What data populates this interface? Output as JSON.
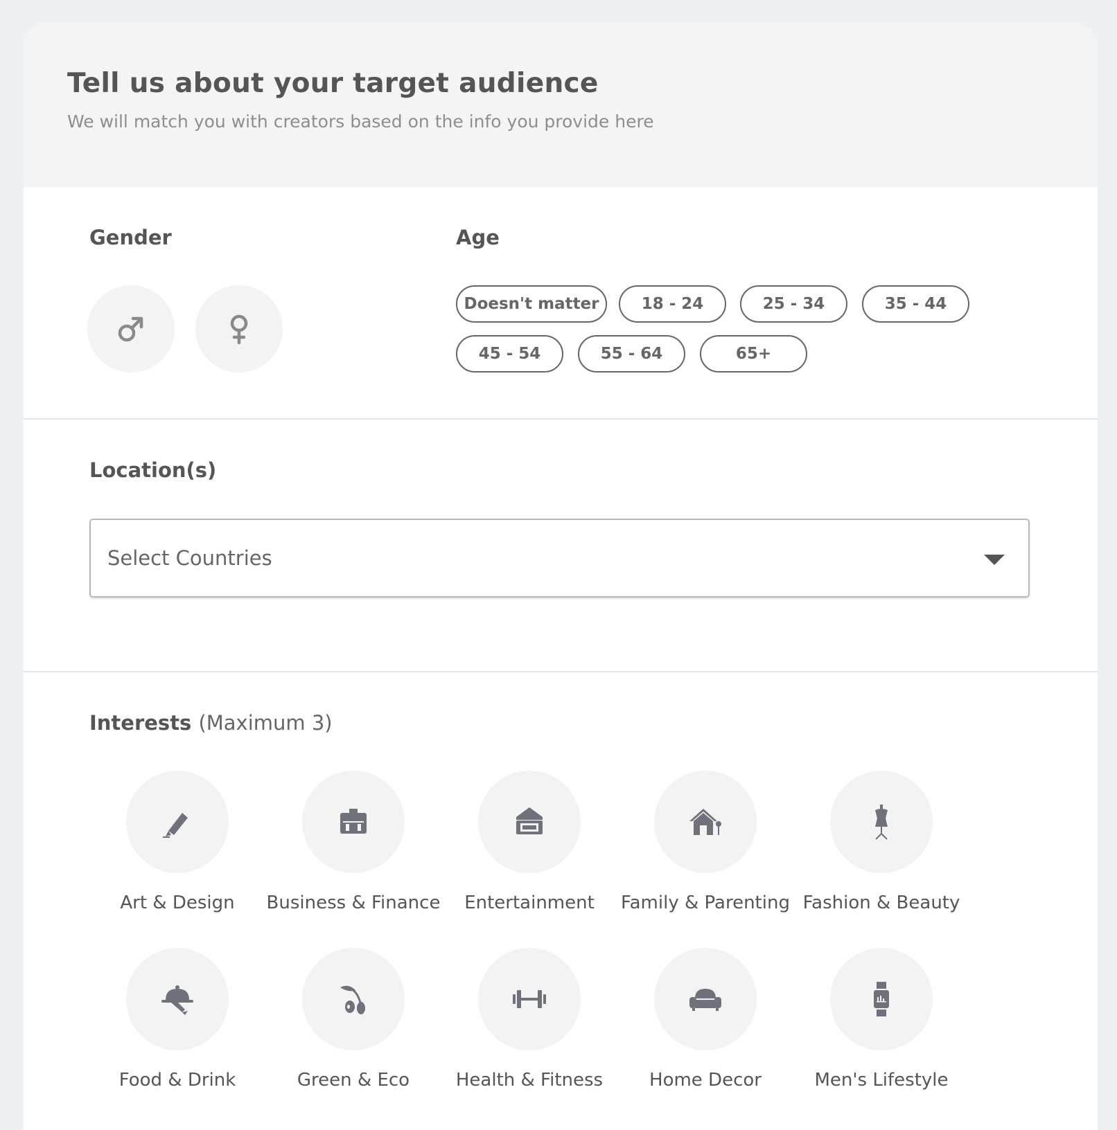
{
  "header": {
    "title": "Tell us about your target audience",
    "subtitle": "We will match you with creators based on the info you provide here"
  },
  "gender": {
    "label": "Gender",
    "options": [
      {
        "icon": "male-icon"
      },
      {
        "icon": "female-icon"
      }
    ]
  },
  "age": {
    "label": "Age",
    "options": [
      "Doesn't matter",
      "18 - 24",
      "25 - 34",
      "35 - 44",
      "45 - 54",
      "55 - 64",
      "65+"
    ]
  },
  "location": {
    "label": "Location(s)",
    "placeholder": "Select Countries"
  },
  "interests": {
    "label": "Interests",
    "note": "(Maximum 3)",
    "items": [
      {
        "label": "Art & Design",
        "icon": "pencil-icon"
      },
      {
        "label": "Business & Finance",
        "icon": "briefcase-icon"
      },
      {
        "label": "Entertainment",
        "icon": "ticket-icon"
      },
      {
        "label": "Family & Parenting",
        "icon": "house-icon"
      },
      {
        "label": "Fashion & Beauty",
        "icon": "mannequin-icon"
      },
      {
        "label": "Food & Drink",
        "icon": "cloche-icon"
      },
      {
        "label": "Green & Eco",
        "icon": "olive-icon"
      },
      {
        "label": "Health & Fitness",
        "icon": "dumbbell-icon"
      },
      {
        "label": "Home Decor",
        "icon": "armchair-icon"
      },
      {
        "label": "Men's Lifestyle",
        "icon": "smartwatch-icon"
      }
    ]
  },
  "colors": {
    "icon": "#6f727a",
    "header_bg": "#f4f4f4",
    "circle_bg": "#f3f3f3"
  }
}
